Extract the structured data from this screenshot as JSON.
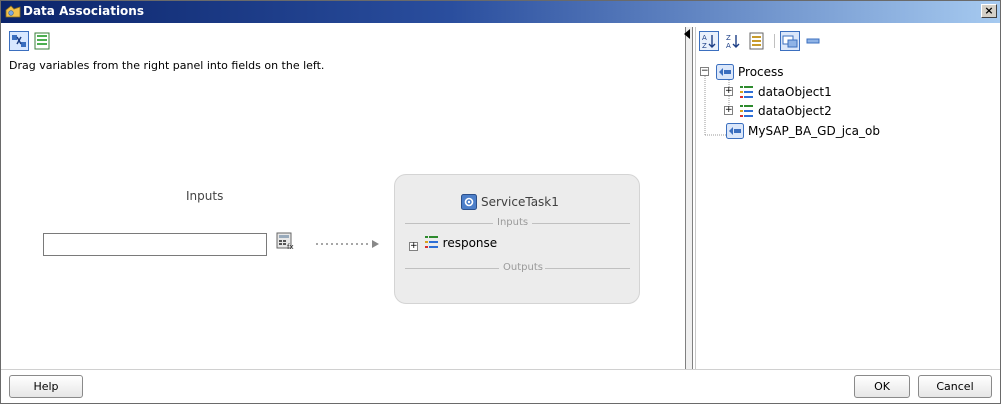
{
  "window": {
    "title": "Data Associations",
    "close_glyph": "×"
  },
  "left_panel": {
    "toolbar": [
      {
        "name": "auto-map-icon"
      },
      {
        "name": "show-source-icon"
      }
    ],
    "instruction": "Drag variables from the right panel into fields on the left.",
    "inputs_label": "Inputs",
    "field_value": "",
    "service_task": {
      "title": "ServiceTask1",
      "inputs_label": "Inputs",
      "outputs_label": "Outputs",
      "item": "response"
    }
  },
  "right_panel": {
    "toolbar": [
      {
        "name": "sort-ascending-icon"
      },
      {
        "name": "sort-descending-icon"
      },
      {
        "name": "details-icon"
      },
      {
        "name": "show-all-icon"
      },
      {
        "name": "collapse-icon"
      }
    ],
    "tree": {
      "root": "Process",
      "children": [
        "dataObject1",
        "dataObject2"
      ],
      "other": "MySAP_BA_GD_jca_ob"
    }
  },
  "buttons": {
    "help": "Help",
    "ok": "OK",
    "cancel": "Cancel"
  },
  "colors": {
    "title_bar": "#0b246a",
    "card_background": "#ececec"
  }
}
